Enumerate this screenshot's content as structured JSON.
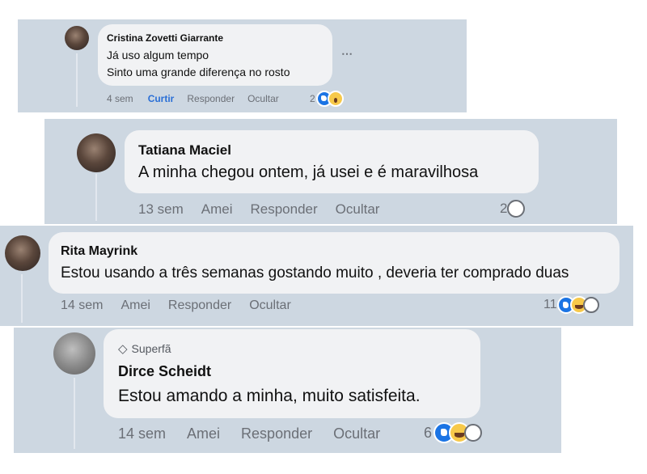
{
  "comments": [
    {
      "author": "Cristina Zovetti Giarrante",
      "lines": [
        "Já uso algum tempo",
        "Sinto uma grande diferença no rosto"
      ],
      "time": "4 sem",
      "like_label": "Curtir",
      "reply_label": "Responder",
      "hide_label": "Ocultar",
      "reaction_count": "2",
      "reactions": [
        "like-icon",
        "wow-icon"
      ],
      "more_icon": "⋯"
    },
    {
      "author": "Tatiana Maciel",
      "lines": [
        "A minha chegou ontem, já usei e é maravilhosa"
      ],
      "time": "13 sem",
      "like_label": "Amei",
      "reply_label": "Responder",
      "hide_label": "Ocultar",
      "reaction_count": "2",
      "reactions": [
        "care-icon"
      ]
    },
    {
      "author": "Rita Mayrink",
      "lines": [
        "Estou usando a três semanas gostando muito , deveria ter comprado duas"
      ],
      "time": "14 sem",
      "like_label": "Amei",
      "reply_label": "Responder",
      "hide_label": "Ocultar",
      "reaction_count": "11",
      "reactions": [
        "like-icon",
        "haha-icon",
        "care-icon"
      ]
    },
    {
      "badge": "Superfã",
      "author": "Dirce Scheidt",
      "lines": [
        "Estou amando a minha, muito satisfeita."
      ],
      "time": "14 sem",
      "like_label": "Amei",
      "reply_label": "Responder",
      "hide_label": "Ocultar",
      "reaction_count": "6",
      "reactions": [
        "like-icon",
        "haha-icon",
        "care-icon"
      ]
    }
  ],
  "colors": {
    "panel": "#cdd7e1",
    "bubble": "#f1f2f4",
    "like_blue": "#1b74e4",
    "action_gray": "#6b6f76"
  }
}
